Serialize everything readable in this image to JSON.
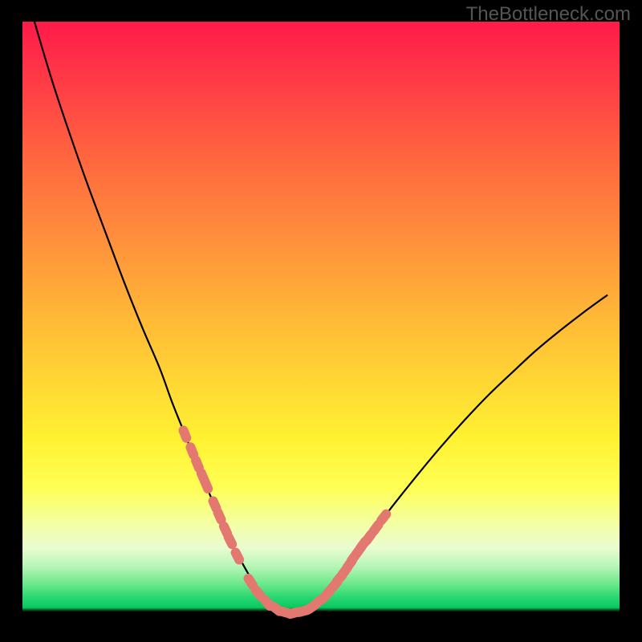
{
  "watermark": "TheBottleneck.com",
  "colors": {
    "background": "#000000",
    "curve": "#000000",
    "marker": "#e37871",
    "watermark": "#555555",
    "gradient_top": "#ff1a4a",
    "gradient_mid": "#fff232",
    "gradient_bottom": "#23d670"
  },
  "chart_data": {
    "type": "line",
    "title": "",
    "xlabel": "",
    "ylabel": "",
    "xlim": [
      0,
      100
    ],
    "ylim": [
      0,
      100
    ],
    "x": [
      2,
      5,
      8,
      11,
      14,
      17,
      20,
      23,
      25,
      27,
      29,
      31,
      32.5,
      34,
      35.5,
      37,
      38.5,
      40,
      42,
      44,
      46,
      49,
      52,
      55,
      58,
      62,
      66,
      70,
      74,
      78,
      82,
      86,
      90,
      94,
      98
    ],
    "y": [
      100,
      90,
      81,
      72.5,
      64.5,
      56.5,
      49,
      42,
      36.5,
      31.5,
      26.5,
      21.8,
      18.3,
      15,
      11.9,
      9.1,
      6.5,
      4.3,
      2.3,
      1.2,
      1.2,
      2.5,
      5.5,
      9.5,
      13.7,
      19,
      24,
      28.8,
      33.3,
      37.5,
      41.3,
      45,
      48.3,
      51.4,
      54.3
    ],
    "markers": {
      "x": [
        27.2,
        28.4,
        29.3,
        30.2,
        30.8,
        32.2,
        33.0,
        34.0,
        34.8,
        36.0,
        38.2,
        39.5,
        41.0,
        42.5,
        44.0,
        45.5,
        47.0,
        48.5,
        50.0,
        51.2,
        52.3,
        53.1,
        54.0,
        54.8,
        55.5,
        56.3,
        57.0,
        58.0,
        59.2,
        60.5
      ],
      "y": [
        31.0,
        28.2,
        26.0,
        23.9,
        22.5,
        19.2,
        17.3,
        15.0,
        13.2,
        10.6,
        6.3,
        4.4,
        2.8,
        1.8,
        1.2,
        1.1,
        1.4,
        2.1,
        3.3,
        4.5,
        5.8,
        6.9,
        8.1,
        9.3,
        10.4,
        11.5,
        12.5,
        13.7,
        15.3,
        17.1
      ]
    }
  }
}
